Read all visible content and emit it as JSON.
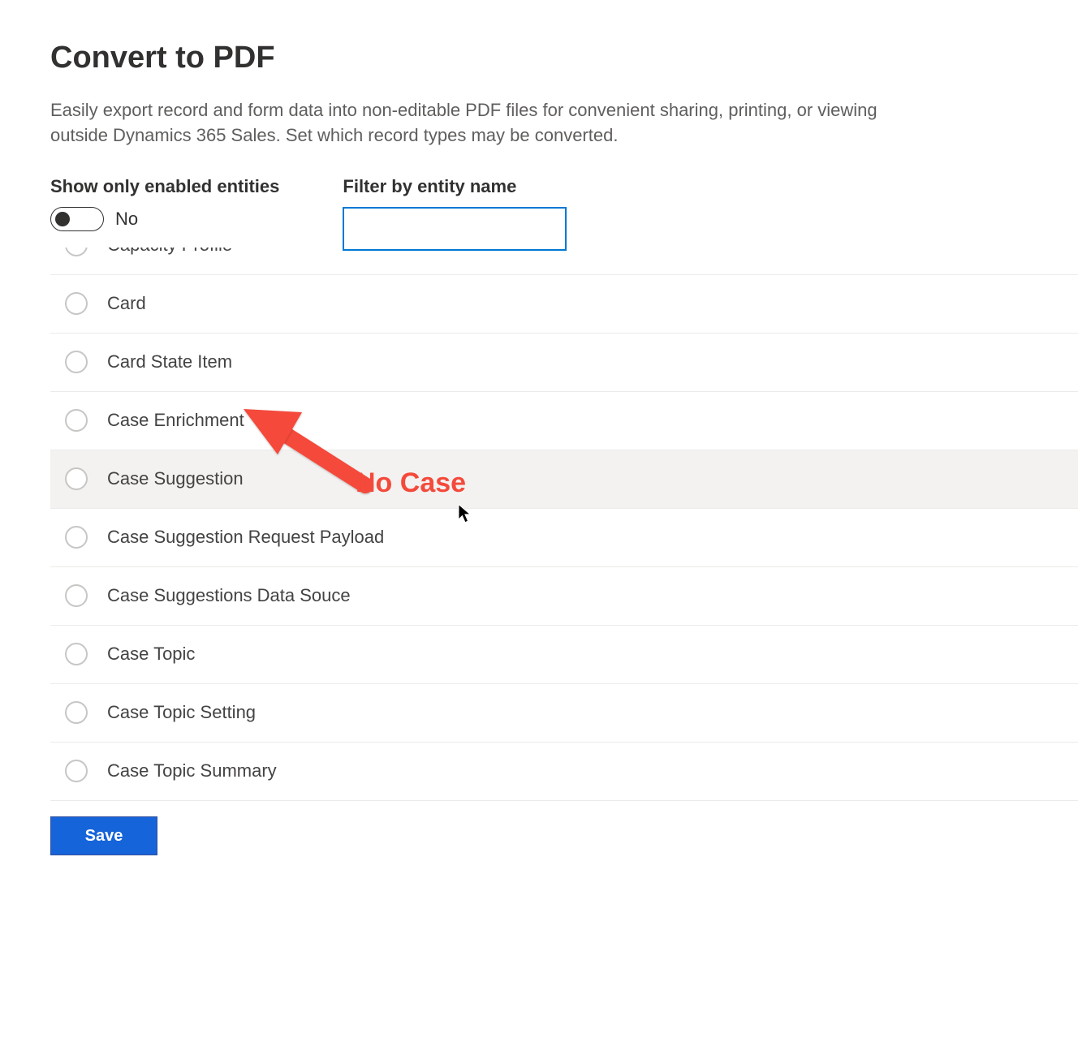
{
  "page": {
    "title": "Convert to PDF",
    "description": "Easily export record and form data into non-editable PDF files for convenient sharing, printing, or viewing outside Dynamics 365 Sales. Set which record types may be converted."
  },
  "controls": {
    "toggle_label": "Show only enabled entities",
    "toggle_state": "No",
    "filter_label": "Filter by entity name",
    "filter_value": ""
  },
  "entities": [
    {
      "label": "Capacity Profile"
    },
    {
      "label": "Card"
    },
    {
      "label": "Card State Item"
    },
    {
      "label": "Case Enrichment"
    },
    {
      "label": "Case Suggestion"
    },
    {
      "label": "Case Suggestion Request Payload"
    },
    {
      "label": "Case Suggestions Data Souce"
    },
    {
      "label": "Case Topic"
    },
    {
      "label": "Case Topic Setting"
    },
    {
      "label": "Case Topic Summary"
    }
  ],
  "hovered_index": 4,
  "buttons": {
    "save": "Save"
  },
  "annotation": {
    "text": "No Case",
    "color": "#f44a3b"
  }
}
